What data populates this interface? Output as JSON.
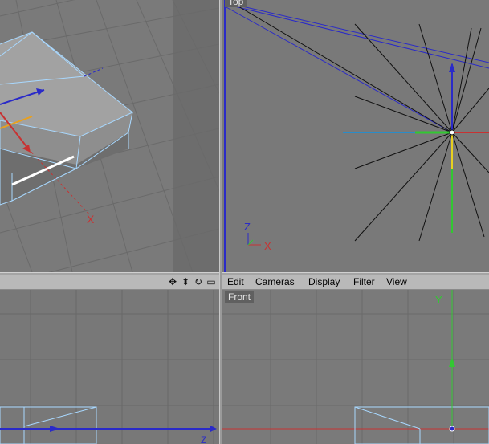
{
  "viewports": {
    "top": {
      "label": "Top"
    },
    "front": {
      "label": "Front"
    }
  },
  "menubar": {
    "items": [
      "Edit",
      "Cameras",
      "Display",
      "Filter",
      "View"
    ]
  },
  "nav_icons": [
    "move-icon",
    "scroll-icon",
    "rotate-icon",
    "maximize-icon"
  ],
  "axis_labels": {
    "persp_x": "X",
    "top_z": "Z",
    "top_x": "X",
    "front_y": "Y",
    "left_z": "Z"
  },
  "colors": {
    "axis_x": "#c83232",
    "axis_y": "#32c832",
    "axis_z": "#2a2ac8",
    "wireframe": "#a8d8ff",
    "viewport_bg": "#797979",
    "menubar_bg": "#b9b9b9"
  }
}
